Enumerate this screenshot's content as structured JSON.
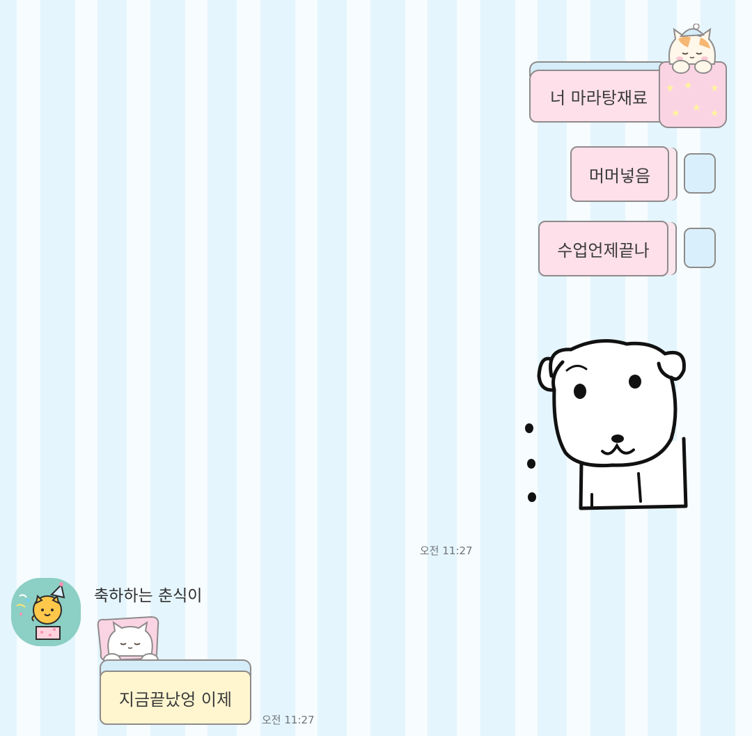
{
  "messages_sent": [
    {
      "text": "너 마라탕재료"
    },
    {
      "text": "머머넣음"
    },
    {
      "text": "수업언제끝나"
    }
  ],
  "sent_time": "오전 11:27",
  "received": {
    "sender": "축하하는 춘식이",
    "text": "지금끝났엉 이제",
    "time": "오전 11:27"
  },
  "icons": {
    "sent_sticker": "puppy-sticker-icon",
    "avatar": "choonsik-party-avatar-icon",
    "bubble_decor": [
      "sleeping-cat-jar-icon",
      "pillow-icon",
      "sleeping-cat-pillow-icon"
    ]
  },
  "colors": {
    "background_stripe_dark": "#e4f5fd",
    "background_stripe_light": "#f7fcff",
    "sent_bubble": "#fde0ea",
    "received_bubble": "#fff6d0",
    "avatar_bg": "#8ccfc4"
  }
}
